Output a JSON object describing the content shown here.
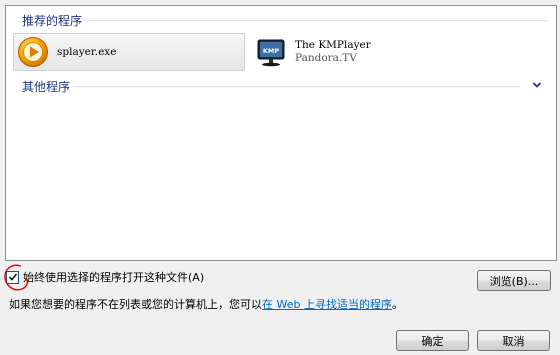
{
  "recommended_group": {
    "title": "推荐的程序"
  },
  "programs": [
    {
      "name": "splayer.exe",
      "publisher": "",
      "icon": "splayer-icon",
      "selected": true
    },
    {
      "name": "The KMPlayer",
      "publisher": "Pandora.TV",
      "icon": "kmplayer-icon",
      "selected": false
    }
  ],
  "other_group": {
    "title": "其他程序",
    "expand_icon": "chevron-down-icon"
  },
  "always_use": {
    "label": "始终使用选择的程序打开这种文件(A)",
    "checked": true
  },
  "browse_button": {
    "label": "浏览(B)..."
  },
  "info": {
    "text_before": "如果您想要的程序不在列表或您的计算机上，您可以",
    "link_text": "在 Web 上寻找适当的程序",
    "text_after": "。"
  },
  "ok_button": {
    "label": "确定"
  },
  "cancel_button": {
    "label": "取消"
  },
  "colors": {
    "group_header": "#1e3287",
    "link": "#0066cc",
    "annotation_circle": "#e00000",
    "window_bg": "#f0f0f0"
  }
}
